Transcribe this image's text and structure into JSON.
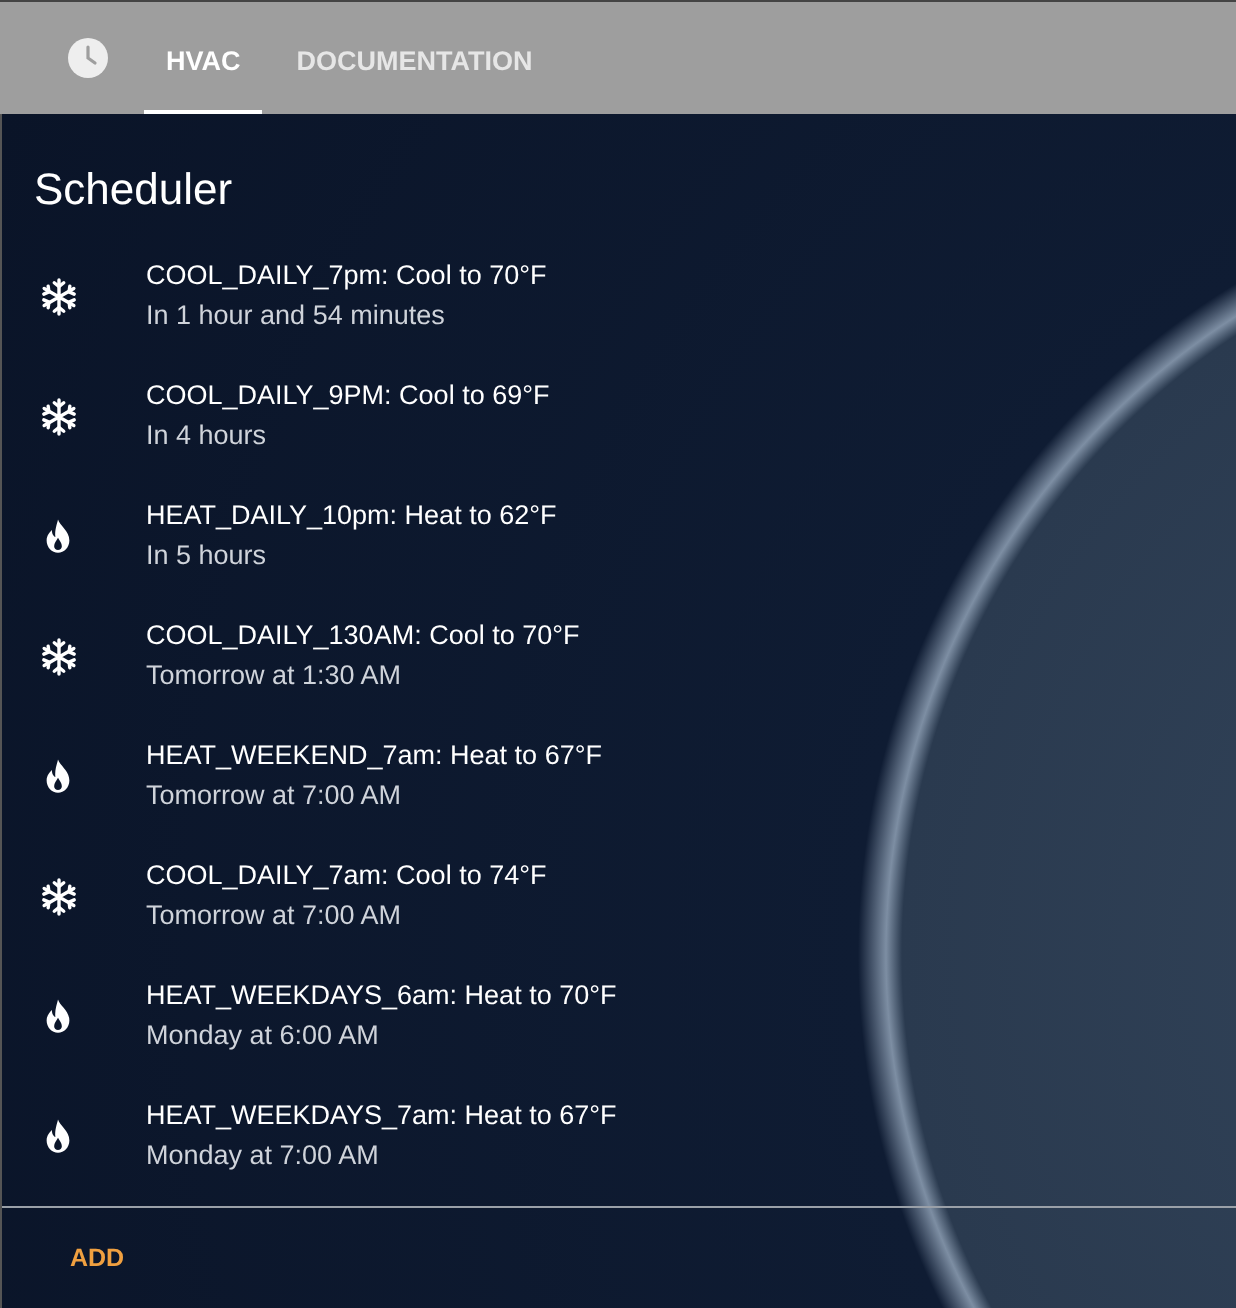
{
  "tabs": [
    {
      "label": "HVAC",
      "selected": true
    },
    {
      "label": "DOCUMENTATION",
      "selected": false
    }
  ],
  "title": "Scheduler",
  "schedules": [
    {
      "kind": "cool",
      "title": "COOL_DAILY_7pm: Cool to 70°F",
      "when": "In 1 hour and 54 minutes"
    },
    {
      "kind": "cool",
      "title": "COOL_DAILY_9PM: Cool to 69°F",
      "when": "In 4 hours"
    },
    {
      "kind": "heat",
      "title": "HEAT_DAILY_10pm: Heat to 62°F",
      "when": "In 5 hours"
    },
    {
      "kind": "cool",
      "title": "COOL_DAILY_130AM: Cool to 70°F",
      "when": "Tomorrow at 1:30 AM"
    },
    {
      "kind": "heat",
      "title": "HEAT_WEEKEND_7am: Heat to 67°F",
      "when": "Tomorrow at 7:00 AM"
    },
    {
      "kind": "cool",
      "title": "COOL_DAILY_7am: Cool to 74°F",
      "when": "Tomorrow at 7:00 AM"
    },
    {
      "kind": "heat",
      "title": "HEAT_WEEKDAYS_6am: Heat to 70°F",
      "when": "Monday at 6:00 AM"
    },
    {
      "kind": "heat",
      "title": "HEAT_WEEKDAYS_7am: Heat to 67°F",
      "when": "Monday at 7:00 AM"
    }
  ],
  "add_button": "ADD"
}
